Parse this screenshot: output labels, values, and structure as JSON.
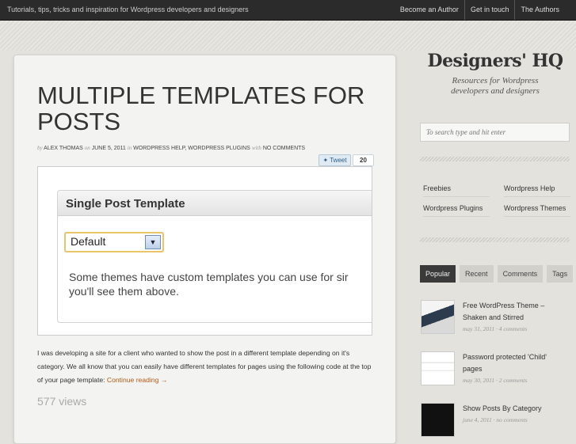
{
  "topbar": {
    "tagline": "Tutorials, tips, tricks and inspiration for Wordpress developers and designers",
    "nav": [
      "Become an Author",
      "Get in touch",
      "The Authors"
    ]
  },
  "post": {
    "title": "MULTIPLE TEMPLATES FOR POSTS",
    "meta": {
      "by": "by",
      "author": "ALEX THOMAS",
      "on": "on",
      "date": "JUNE 5, 2011",
      "in": "in",
      "categories": "WORDPRESS HELP, WORDPRESS PLUGINS",
      "with": "with",
      "comments": "NO COMMENTS"
    },
    "tweet_label": "Tweet",
    "tweet_count": "20",
    "screenshot": {
      "heading": "Single Post Template",
      "select_value": "Default",
      "line1": "Some themes have custom templates you can use for sir",
      "line2": "you'll see them above."
    },
    "excerpt": "I was developing a site for a client who wanted to show the post in a different template depending on it's category. We all know that you can easily have different templates for pages using the following code at the top of your page template:",
    "continue_label": "Continue reading →",
    "views": "577 views"
  },
  "sidebar": {
    "logo": "Designers' HQ",
    "subtitle_line1": "Resources for Wordpress",
    "subtitle_line2": "developers and designers",
    "search_placeholder": "To search type and hit enter",
    "categories": [
      "Freebies",
      "Wordpress Help",
      "Wordpress Plugins",
      "Wordpress Themes"
    ],
    "tabs": [
      "Popular",
      "Recent",
      "Comments",
      "Tags"
    ],
    "popular": [
      {
        "title": "Free WordPress Theme – Shaken and Stirred",
        "meta": "may 31, 2011 · 4 comments"
      },
      {
        "title": "Password protected 'Child' pages",
        "meta": "may 30, 2011 · 2 comments"
      },
      {
        "title": "Show Posts By Category",
        "meta": "june 4, 2011 · no comments"
      }
    ]
  }
}
